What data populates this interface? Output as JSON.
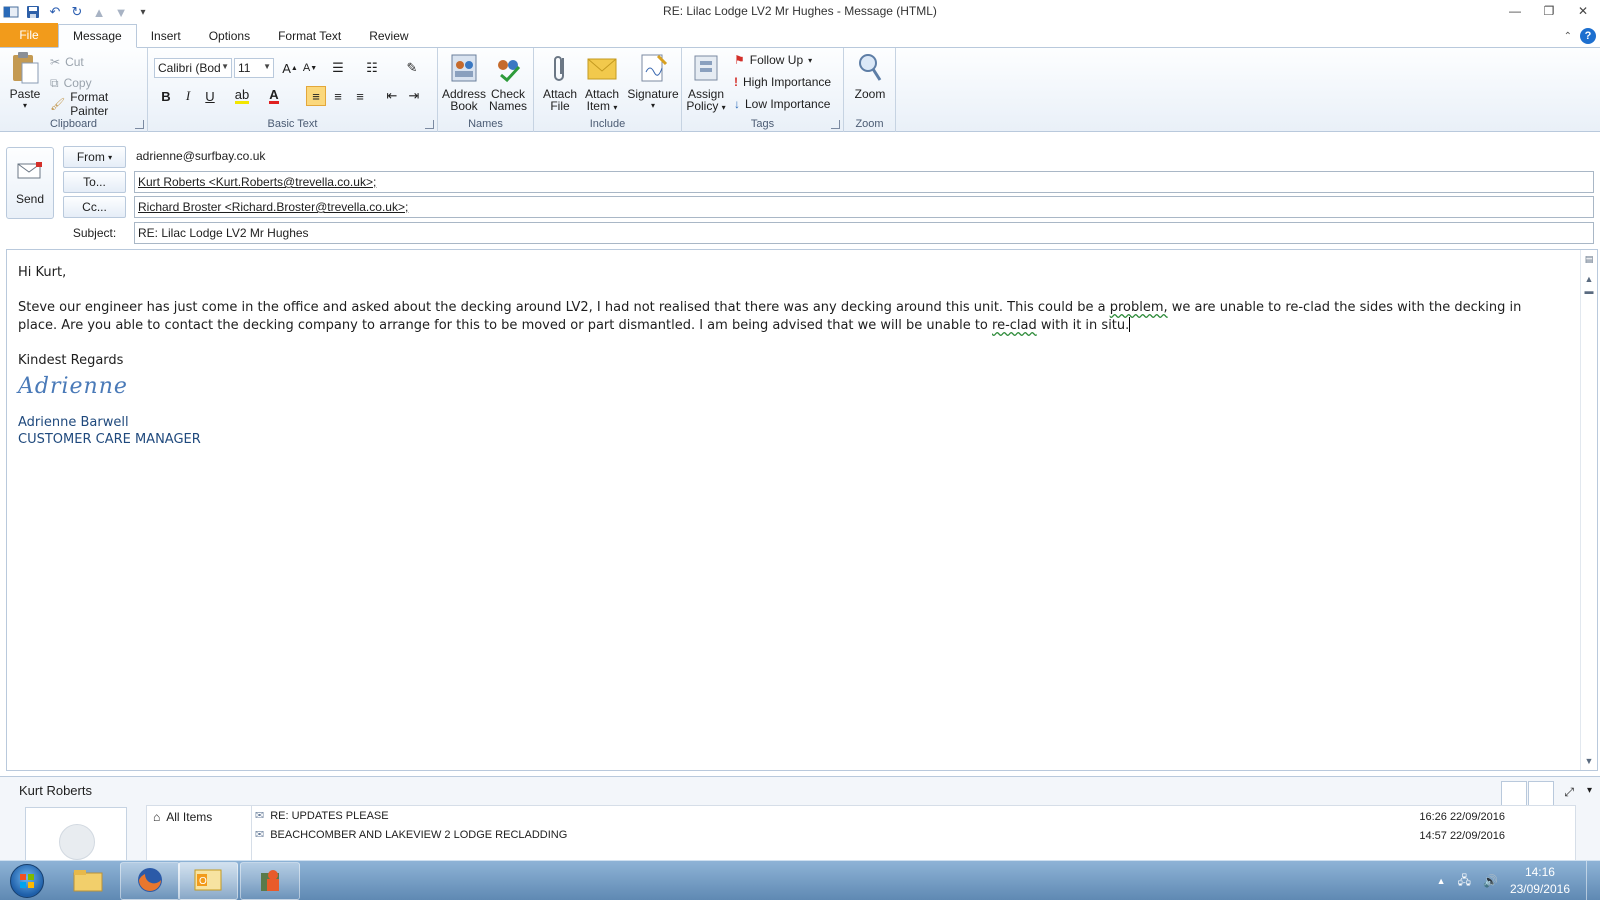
{
  "window": {
    "title": "RE: Lilac Lodge LV2 Mr Hughes  -  Message (HTML)"
  },
  "tabs": [
    "File",
    "Message",
    "Insert",
    "Options",
    "Format Text",
    "Review"
  ],
  "ribbon": {
    "clipboard": {
      "paste": "Paste",
      "cut": "Cut",
      "copy": "Copy",
      "format_painter": "Format Painter",
      "label": "Clipboard"
    },
    "basic_text": {
      "font": "Calibri (Body)",
      "size": "11",
      "bold": "B",
      "italic": "I",
      "underline": "U",
      "label": "Basic Text"
    },
    "names": {
      "address_book_line1": "Address",
      "address_book_line2": "Book",
      "check_names_line1": "Check",
      "check_names_line2": "Names",
      "label": "Names"
    },
    "include": {
      "attach_file_line1": "Attach",
      "attach_file_line2": "File",
      "attach_item_line1": "Attach",
      "attach_item_line2": "Item",
      "signature": "Signature",
      "label": "Include"
    },
    "tags": {
      "assign_policy_line1": "Assign",
      "assign_policy_line2": "Policy",
      "follow_up": "Follow Up",
      "high_importance": "High Importance",
      "low_importance": "Low Importance",
      "label": "Tags"
    },
    "zoom": {
      "zoom_button": "Zoom",
      "label": "Zoom"
    }
  },
  "compose": {
    "send": "Send",
    "from_button": "From",
    "from_value": "adrienne@surfbay.co.uk",
    "to_button": "To...",
    "to_value": "Kurt Roberts <Kurt.Roberts@trevella.co.uk>;",
    "cc_button": "Cc...",
    "cc_value": "Richard Broster <Richard.Broster@trevella.co.uk>;",
    "subject_label": "Subject:",
    "subject_value": "RE: Lilac Lodge LV2 Mr Hughes"
  },
  "body": {
    "greeting": "Hi Kurt,",
    "p1_a": "Steve our engineer has just come in the office and asked about the decking around LV2, I had not realised that there was any decking around this unit.  This could be a ",
    "p1_problem": "problem,",
    "p1_b": " we are unable to re-clad the sides with the decking in place.   Are you able to contact the decking company to arrange for this to be moved or part dismantled.  I am being advised that we will be unable to ",
    "p1_reclad": "re-clad",
    "p1_c": " with it in situ.",
    "closing": "Kindest Regards",
    "signature_script": "Adrienne",
    "sig_name": "Adrienne Barwell",
    "sig_title": "CUSTOMER CARE MANAGER"
  },
  "people_pane": {
    "name": "Kurt Roberts",
    "all_items": "All Items",
    "items": [
      {
        "subject": "RE: UPDATES PLEASE",
        "time": "16:26  22/09/2016"
      },
      {
        "subject": "BEACHCOMBER AND LAKEVIEW 2 LODGE RECLADDING",
        "time": "14:57  22/09/2016"
      }
    ]
  },
  "taskbar": {
    "time": "14:16",
    "date": "23/09/2016"
  },
  "colors": {
    "file_tab": "#f29b1b",
    "signature_blue": "#1f497d",
    "ribbon_bg": "#e9f0f8"
  }
}
